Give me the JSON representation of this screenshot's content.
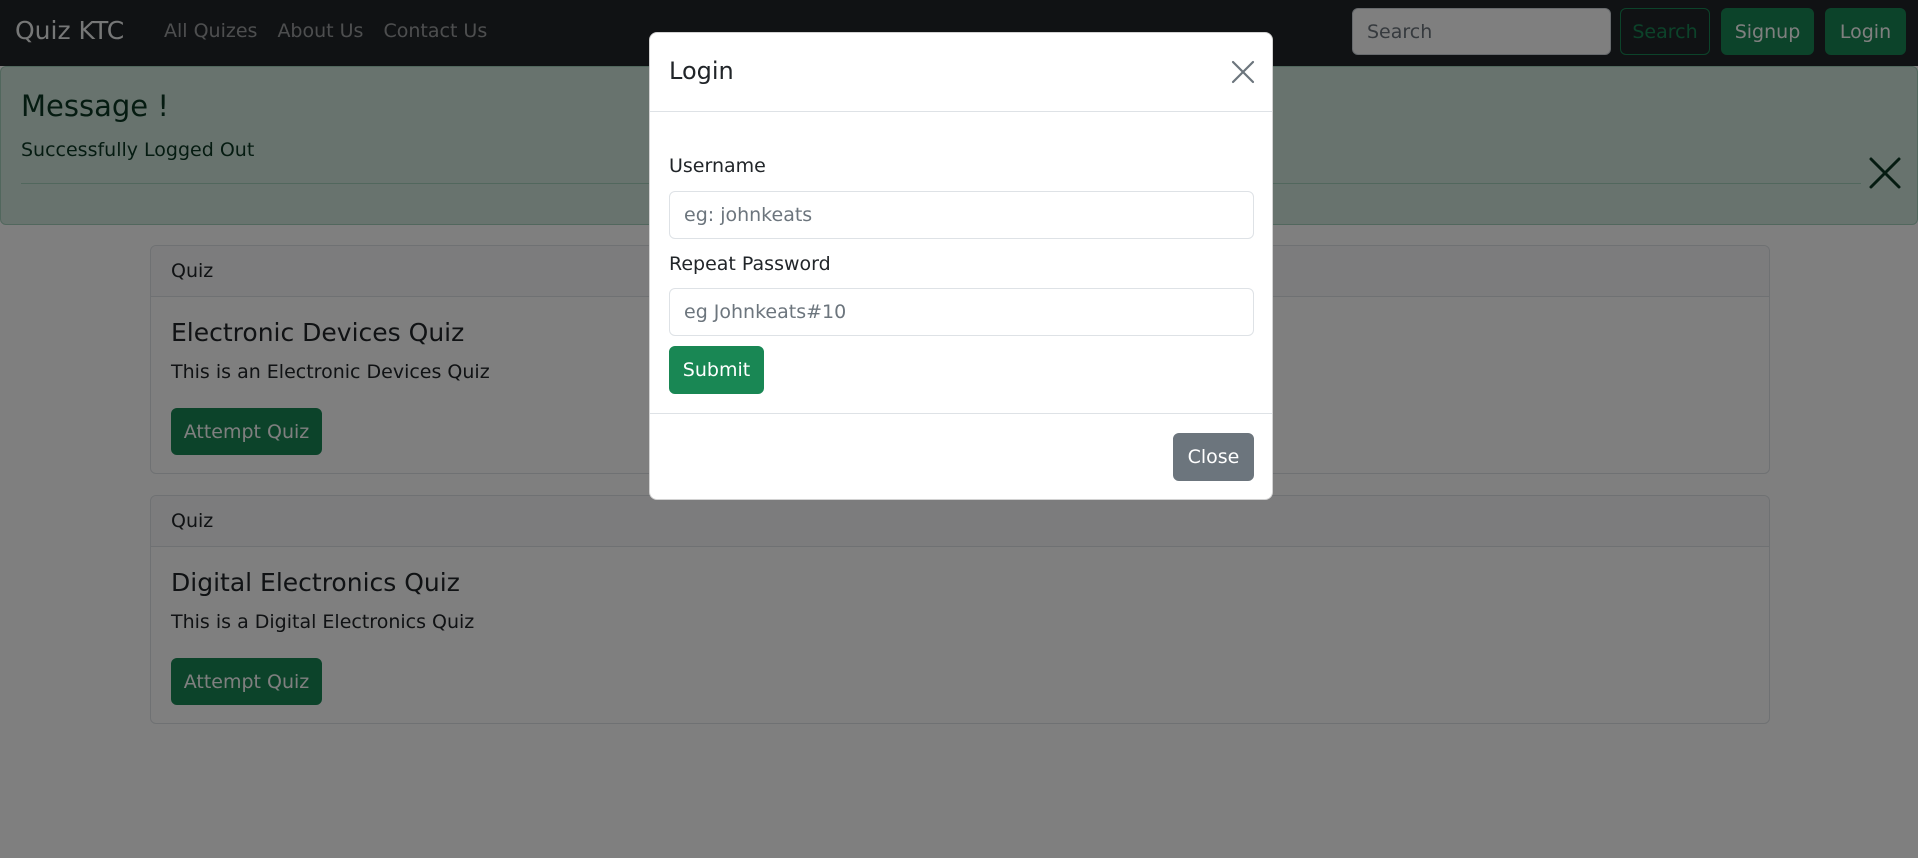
{
  "navbar": {
    "brand": "Quiz KTC",
    "links": [
      "All Quizes",
      "About Us",
      "Contact Us"
    ],
    "search_placeholder": "Search",
    "search_button": "Search",
    "signup_button": "Signup",
    "login_button": "Login"
  },
  "alert": {
    "title": "Message !",
    "text": "Successfully Logged Out",
    "close_icon": "close-icon"
  },
  "cards": [
    {
      "header": "Quiz",
      "title": "Electronic Devices Quiz",
      "text": "This is an Electronic Devices Quiz",
      "button": "Attempt Quiz"
    },
    {
      "header": "Quiz",
      "title": "Digital Electronics Quiz",
      "text": "This is a Digital Electronics Quiz",
      "button": "Attempt Quiz"
    }
  ],
  "modal": {
    "title": "Login",
    "close_icon": "close-icon",
    "username_label": "Username",
    "username_placeholder": "eg: johnkeats",
    "password_label": "Repeat Password",
    "password_placeholder": "eg Johnkeats#10",
    "submit_button": "Submit",
    "close_button": "Close"
  },
  "colors": {
    "navbar_bg": "#212529",
    "success": "#198754",
    "secondary": "#6c757d",
    "alert_bg": "#d1e7dd"
  }
}
